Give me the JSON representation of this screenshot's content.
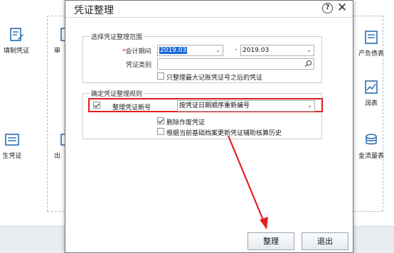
{
  "background": {
    "tiles": [
      {
        "id": "fill-voucher",
        "label": "填制凭证"
      },
      {
        "id": "audit",
        "label": "审"
      },
      {
        "id": "gen-voucher",
        "label": "生凭证"
      },
      {
        "id": "out",
        "label": "出"
      },
      {
        "id": "balance-sheet",
        "label": "产负债表"
      },
      {
        "id": "profit",
        "label": "润表"
      },
      {
        "id": "cashflow",
        "label": "金流量表"
      }
    ]
  },
  "dialog": {
    "title": "凭证整理",
    "help_glyph": "?",
    "close_glyph": "✕",
    "range_group": {
      "legend": "选择凭证整理范围",
      "period_label": "会计期间",
      "required_mark": "*",
      "period_from": "2019.03",
      "period_separator": "-",
      "period_to": "2019.03",
      "voucher_type_label": "凭证类别",
      "voucher_type_value": "",
      "only_after_max_label": "只整理最大记账凭证号之后的凭证",
      "only_after_max_checked": false
    },
    "rules_group": {
      "legend": "确定凭证整理规则",
      "renumber_label": "整理凭证断号",
      "renumber_checked": true,
      "renumber_mode": "按凭证日期顺序重新编号",
      "delete_voided_label": "删除作废凭证",
      "delete_voided_checked": true,
      "update_aux_label": "根据当前基础档案更新凭证辅助核算历史",
      "update_aux_checked": false
    },
    "buttons": {
      "ok": "整理",
      "cancel": "退出"
    },
    "annotation_color": "#e02020"
  }
}
